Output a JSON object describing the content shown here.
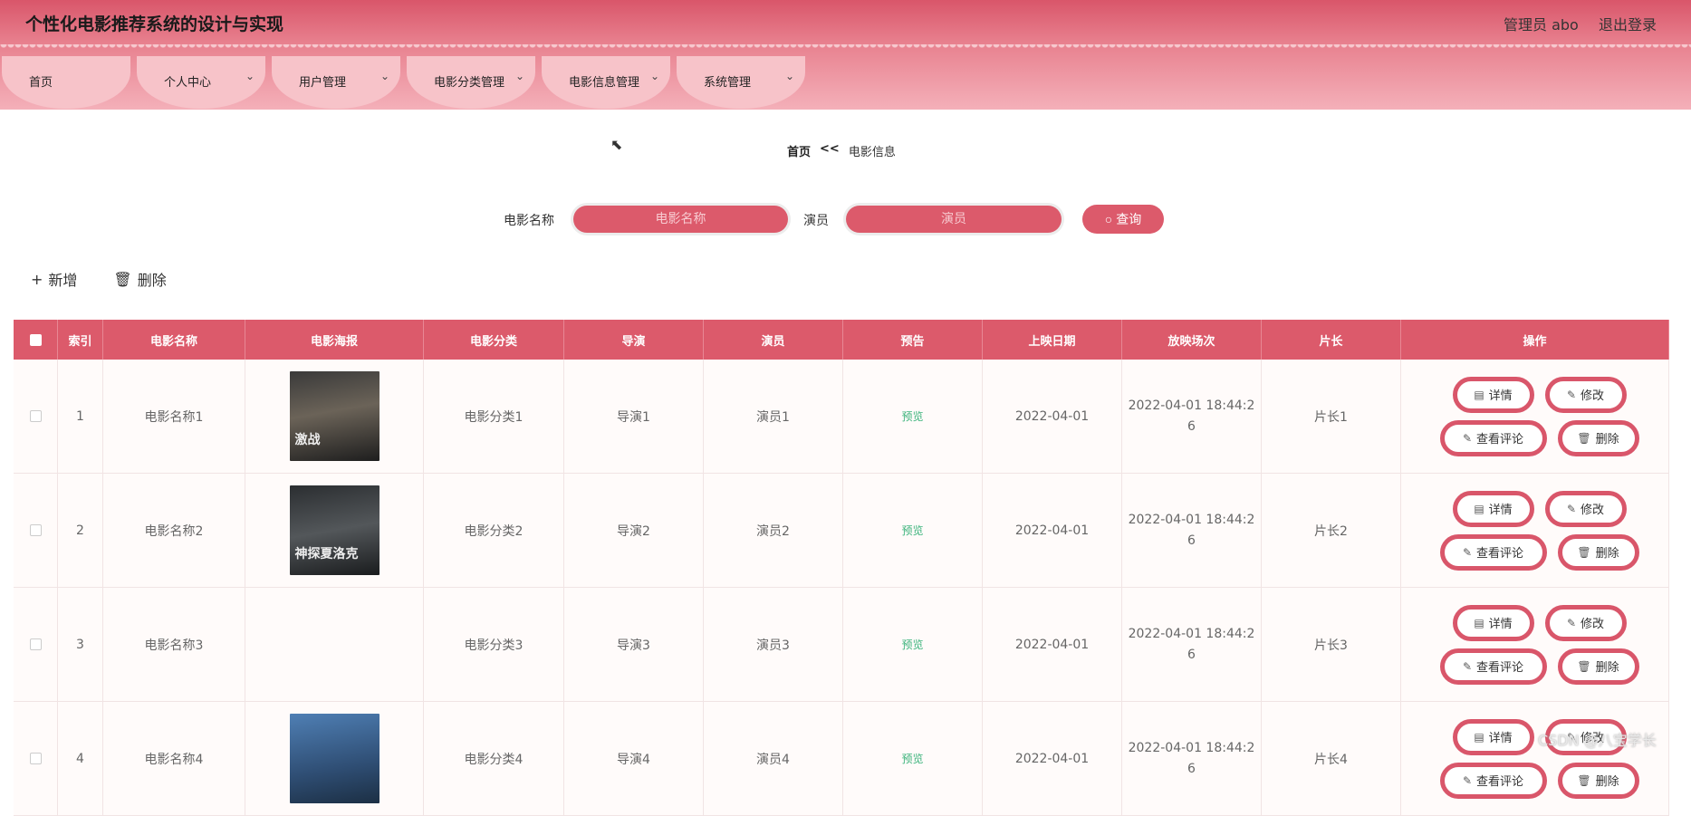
{
  "header": {
    "title": "个性化电影推荐系统的设计与实现",
    "admin": "管理员 abo",
    "logout": "退出登录"
  },
  "nav": [
    {
      "label": "首页",
      "has_dropdown": false
    },
    {
      "label": "个人中心",
      "has_dropdown": true
    },
    {
      "label": "用户管理",
      "has_dropdown": true
    },
    {
      "label": "电影分类管理",
      "has_dropdown": true
    },
    {
      "label": "电影信息管理",
      "has_dropdown": true
    },
    {
      "label": "系统管理",
      "has_dropdown": true
    }
  ],
  "breadcrumb": {
    "home": "首页",
    "sep": "<<",
    "current": "电影信息"
  },
  "search": {
    "name_label": "电影名称",
    "name_placeholder": "电影名称",
    "actor_label": "演员",
    "actor_placeholder": "演员",
    "query_label": "查询"
  },
  "toolbar": {
    "add_label": "新增",
    "delete_label": "删除"
  },
  "table": {
    "headers": [
      "索引",
      "电影名称",
      "电影海报",
      "电影分类",
      "导演",
      "演员",
      "预告",
      "上映日期",
      "放映场次",
      "片长",
      "操作"
    ],
    "rows": [
      {
        "index": "1",
        "name": "电影名称1",
        "poster_text": "激战",
        "category": "电影分类1",
        "director": "导演1",
        "actor": "演员1",
        "preview": "预览",
        "date": "2022-04-01",
        "showtime_line1": "2022-04-01 18:44:2",
        "showtime_line2": "6",
        "length": "片长1"
      },
      {
        "index": "2",
        "name": "电影名称2",
        "poster_text": "神探夏洛克",
        "category": "电影分类2",
        "director": "导演2",
        "actor": "演员2",
        "preview": "预览",
        "date": "2022-04-01",
        "showtime_line1": "2022-04-01 18:44:2",
        "showtime_line2": "6",
        "length": "片长2"
      },
      {
        "index": "3",
        "name": "电影名称3",
        "poster_text": "",
        "category": "电影分类3",
        "director": "导演3",
        "actor": "演员3",
        "preview": "预览",
        "date": "2022-04-01",
        "showtime_line1": "2022-04-01 18:44:2",
        "showtime_line2": "6",
        "length": "片长3"
      },
      {
        "index": "4",
        "name": "电影名称4",
        "poster_text": "",
        "category": "电影分类4",
        "director": "导演4",
        "actor": "演员4",
        "preview": "预览",
        "date": "2022-04-01",
        "showtime_line1": "2022-04-01 18:44:2",
        "showtime_line2": "6",
        "length": "片长4"
      }
    ],
    "ops": {
      "detail": "详情",
      "edit": "修改",
      "comments": "查看评论",
      "delete": "删除"
    }
  },
  "watermark": "CSDN @八宝学长",
  "colors": {
    "primary": "#dc5a6b",
    "nav_tab": "#f7c3c9",
    "preview_link": "#3bb37b"
  }
}
